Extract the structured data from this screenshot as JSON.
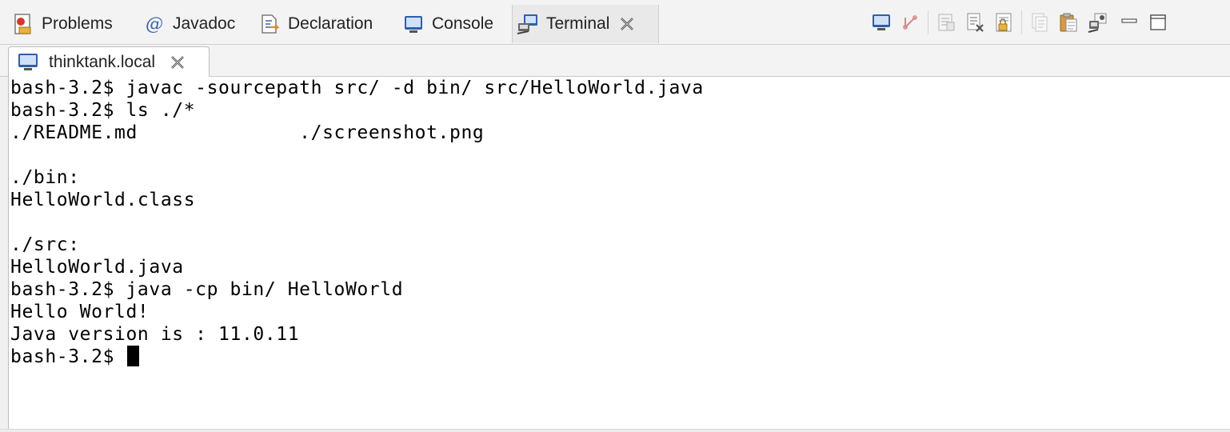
{
  "view_tabs": [
    {
      "label": "Problems",
      "icon": "problems-icon"
    },
    {
      "label": "Javadoc",
      "icon": "at-icon"
    },
    {
      "label": "Declaration",
      "icon": "declaration-icon"
    },
    {
      "label": "Console",
      "icon": "console-icon"
    },
    {
      "label": "Terminal",
      "icon": "terminal-icon",
      "active": true
    }
  ],
  "toolbar_icons": [
    "open-terminal-icon",
    "toggle-command-input-icon",
    "scroll-lock-icon",
    "disconnect-icon",
    "lock-icon",
    "copy-icon",
    "paste-icon",
    "settings-icon",
    "minimize-icon",
    "maximize-icon"
  ],
  "terminal_tab": {
    "label": "thinktank.local",
    "icon": "terminal-connection-icon"
  },
  "terminal": {
    "lines": [
      "bash-3.2$ javac -sourcepath src/ -d bin/ src/HelloWorld.java",
      "bash-3.2$ ls ./*",
      "./README.md              ./screenshot.png",
      "",
      "./bin:",
      "HelloWorld.class",
      "",
      "./src:",
      "HelloWorld.java",
      "bash-3.2$ java -cp bin/ HelloWorld",
      "Hello World!",
      "Java version is : 11.0.11"
    ],
    "prompt": "bash-3.2$ "
  },
  "colors": {
    "accent_blue": "#2f5fa8",
    "tab_bg": "#f3f3f3",
    "terminal_bg": "#ffffff",
    "text": "#000000"
  }
}
